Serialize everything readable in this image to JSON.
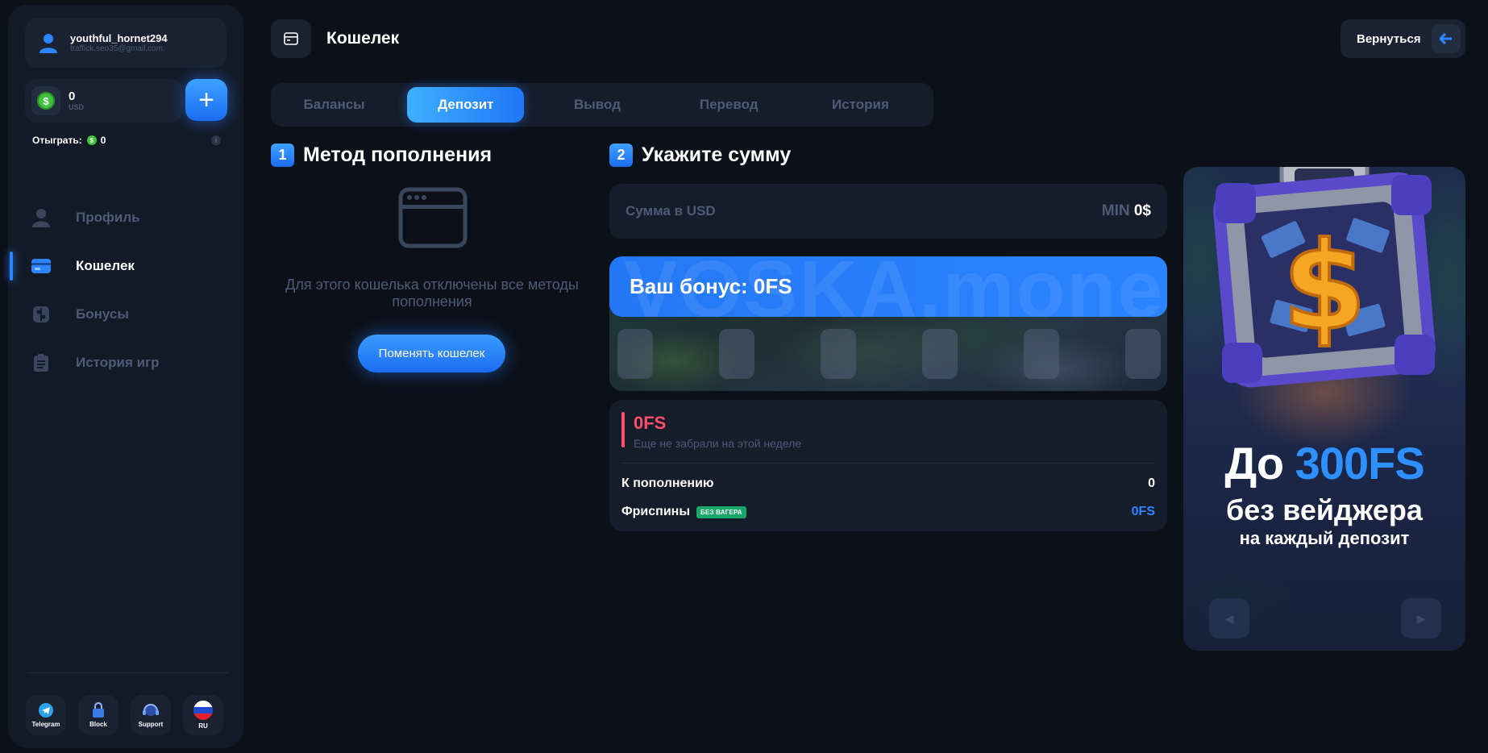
{
  "user": {
    "name": "youthful_hornet294",
    "email": "traffick.seo35@gmail.com"
  },
  "balance": {
    "value": "0",
    "currency": "USD"
  },
  "wager": {
    "label": "Отыграть:",
    "value": "0"
  },
  "nav": [
    {
      "label": "Профиль",
      "icon": "user-icon"
    },
    {
      "label": "Кошелек",
      "icon": "wallet-icon",
      "active": true
    },
    {
      "label": "Бонусы",
      "icon": "gift-icon"
    },
    {
      "label": "История игр",
      "icon": "clipboard-icon"
    }
  ],
  "social": [
    {
      "label": "Telegram",
      "icon": "telegram-icon"
    },
    {
      "label": "Block",
      "icon": "lock-icon"
    },
    {
      "label": "Support",
      "icon": "headset-icon"
    },
    {
      "label": "RU",
      "icon": "russia-flag-icon"
    }
  ],
  "header": {
    "title": "Кошелек",
    "back_label": "Вернуться"
  },
  "tabs": [
    {
      "label": "Балансы"
    },
    {
      "label": "Депозит",
      "active": true
    },
    {
      "label": "Вывод"
    },
    {
      "label": "Перевод"
    },
    {
      "label": "История"
    }
  ],
  "step1": {
    "num": "1",
    "title": "Метод пополнения",
    "disabled_text": "Для этого кошелька отключены все методы пополнения",
    "change_button": "Поменять кошелек"
  },
  "step2": {
    "num": "2",
    "title": "Укажите сумму",
    "amount_placeholder": "Сумма в USD",
    "min_label": "MIN",
    "min_value": "0$",
    "bonus_watermark": "VOSKA.mone",
    "bonus_text": "Ваш бонус: 0FS",
    "fs_value": "0FS",
    "fs_sub": "Еще не забрали на этой неделе",
    "deposit_label": "К пополнению",
    "deposit_value": "0",
    "freespins_label": "Фриспины",
    "freespins_badge": "БЕЗ ВАГЕРА",
    "freespins_value": "0FS"
  },
  "promo": {
    "line1_prefix": "До",
    "line1_accent": "300FS",
    "line2": "без вейджера",
    "line3": "на каждый депозит"
  },
  "colors": {
    "accent": "#2e84ff",
    "danger": "#ff4d6a",
    "success": "#17a86a",
    "bg": "#0c1019",
    "panel": "#151c2a"
  }
}
